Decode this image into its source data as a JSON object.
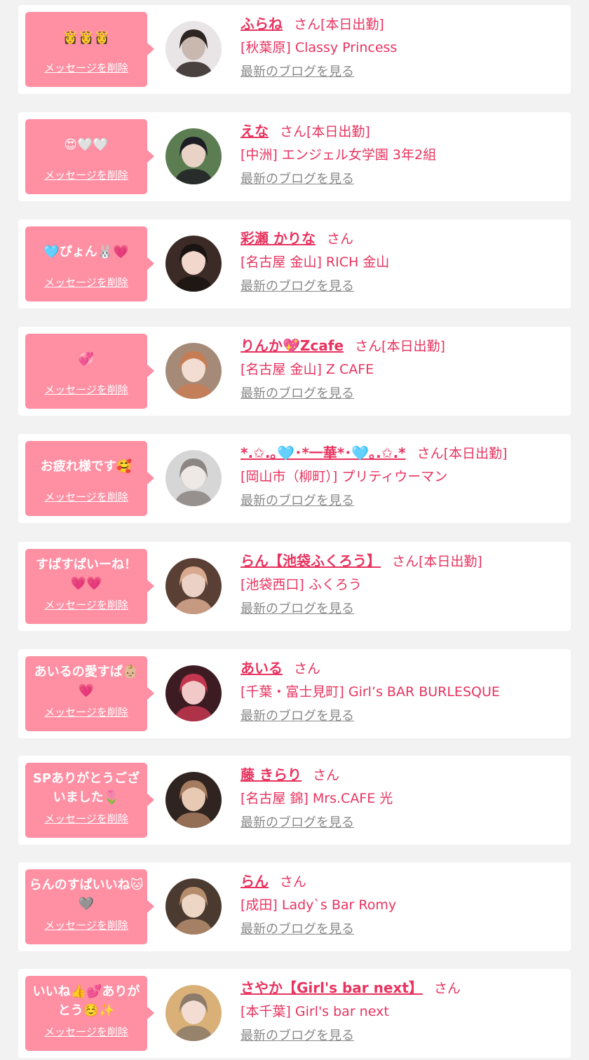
{
  "common": {
    "delete_label": "メッセージを削除",
    "blog_label": "最新のブログを見る",
    "san_label": "さん"
  },
  "messages": [
    {
      "text": "👸👸👸",
      "name": "ふらね",
      "status": "[本日出勤]",
      "shop": "[秋葉原] Classy Princess",
      "avatar_colors": [
        "#e9e4e6",
        "#c9b8b0",
        "#2d2522"
      ]
    },
    {
      "text": "😍🤍🤍",
      "name": "えな",
      "status": "[本日出勤]",
      "shop": "[中洲] エンジェル女学園 3年2組",
      "avatar_colors": [
        "#5c7d52",
        "#e8d3c6",
        "#1f1d24"
      ]
    },
    {
      "text": "🩵ぴょん🐰💗",
      "name": "彩瀬 かりな",
      "status": "",
      "shop": "[名古屋 金山] RICH 金山",
      "avatar_colors": [
        "#3b2a25",
        "#f1d7cc",
        "#1a1412"
      ]
    },
    {
      "text": "💞",
      "name": "りんか💖Zcafe",
      "status": "[本日出勤]",
      "shop": "[名古屋 金山] Z CAFE",
      "avatar_colors": [
        "#a58a78",
        "#f3ddd2",
        "#c77d54"
      ]
    },
    {
      "text": "お疲れ様です🥰",
      "name": "*.✩.｡🩵･*一華*･🩵｡.✩.*",
      "status": "[本日出勤]",
      "shop": "[岡山市（柳町）] プリティウーマン",
      "avatar_colors": [
        "#d6d6d6",
        "#efe9e6",
        "#8b8583"
      ]
    },
    {
      "text": "すぱすぱいーね！💗💗",
      "name": "らん【池袋ふくろう】",
      "status": "[本日出勤]",
      "shop": "[池袋西口] ふくろう",
      "avatar_colors": [
        "#5a4034",
        "#ecd2c6",
        "#d9a98f"
      ]
    },
    {
      "text": "あいるの愛すぱ👶🏼💗",
      "name": "あいる",
      "status": "",
      "shop": "[千葉・富士見町] Girl’s BAR BURLESQUE",
      "avatar_colors": [
        "#3d1b22",
        "#f2c9c9",
        "#c2364f"
      ]
    },
    {
      "text": "SPありがとうございました🌷",
      "name": "藤 きらり",
      "status": "",
      "shop": "[名古屋 錦] Mrs.CAFE 光",
      "avatar_colors": [
        "#2f2420",
        "#e8c9b4",
        "#a67c60"
      ]
    },
    {
      "text": "らんのすぱいいね🐱🩶",
      "name": "らん",
      "status": "",
      "shop": "[成田] Lady`s Bar Romy",
      "avatar_colors": [
        "#4a3a30",
        "#eed6c4",
        "#b58d6d"
      ]
    },
    {
      "text": "いいね👍💕ありがとう☺️✨",
      "name": "さやか【Girl's bar next】",
      "status": "",
      "shop": "[本千葉] Girl's bar next",
      "avatar_colors": [
        "#d8b078",
        "#f3ddd2",
        "#8c7a6a"
      ]
    }
  ]
}
